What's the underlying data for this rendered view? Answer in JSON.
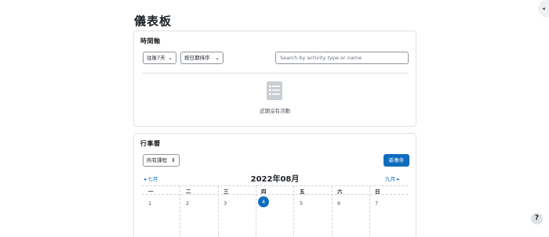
{
  "page": {
    "title": "儀表板"
  },
  "drawer_toggle": {
    "glyph": "◂"
  },
  "help": {
    "label": "?"
  },
  "timeline": {
    "title": "時間軸",
    "filter_date": "往後7天",
    "filter_sort": "按日期排序",
    "search_placeholder": "Search by activity type or name",
    "empty_message": "近期沒有活動"
  },
  "calendar": {
    "title": "行事曆",
    "course_select": "所有課程",
    "new_event": "新事件",
    "prev_month": "◂ 七月",
    "next_month": "九月 ▸",
    "month_label": "2022年08月",
    "weekdays": [
      "一",
      "二",
      "三",
      "四",
      "五",
      "六",
      "日"
    ],
    "days": [
      "1",
      "2",
      "3",
      "4",
      "5",
      "6",
      "7"
    ],
    "today_index": 3
  },
  "colors": {
    "accent": "#0f6cbf",
    "border": "#dee2e6"
  }
}
